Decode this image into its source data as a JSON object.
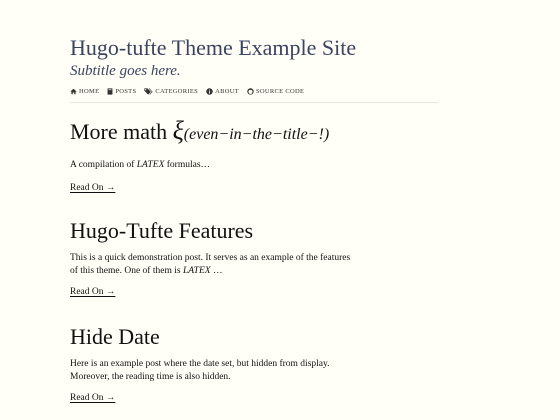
{
  "site": {
    "title": "Hugo-tufte Theme Example Site",
    "subtitle": "Subtitle goes here."
  },
  "nav": {
    "items": [
      {
        "label": "Home",
        "icon": "home-icon"
      },
      {
        "label": "Posts",
        "icon": "book-icon"
      },
      {
        "label": "Categories",
        "icon": "tags-icon"
      },
      {
        "label": "About",
        "icon": "info-icon"
      },
      {
        "label": "Source Code",
        "icon": "github-icon"
      }
    ]
  },
  "posts": [
    {
      "title_text": "More math ",
      "title_symbol": "ξ",
      "title_subscript": "(even−in−the−title−!)",
      "summary_prefix": "A compilation of ",
      "summary_latex": "LATEX",
      "summary_suffix": " formulas…",
      "read_on": "Read On →"
    },
    {
      "title_text": "Hugo-Tufte Features",
      "summary_line1": "This is a quick demonstration post. It serves as an example of the features",
      "summary_prefix": "of this theme. One of them is ",
      "summary_latex": "LATEX",
      "summary_suffix": " …",
      "read_on": "Read On →"
    },
    {
      "title_text": "Hide Date",
      "summary_line1": "Here is an example post where the date set, but hidden from display.",
      "summary_line2": "Moreover, the reading time is also hidden.",
      "read_on": "Read On →"
    }
  ],
  "colors": {
    "background": "#fffff8",
    "title": "#3a4360",
    "text": "#111111"
  }
}
